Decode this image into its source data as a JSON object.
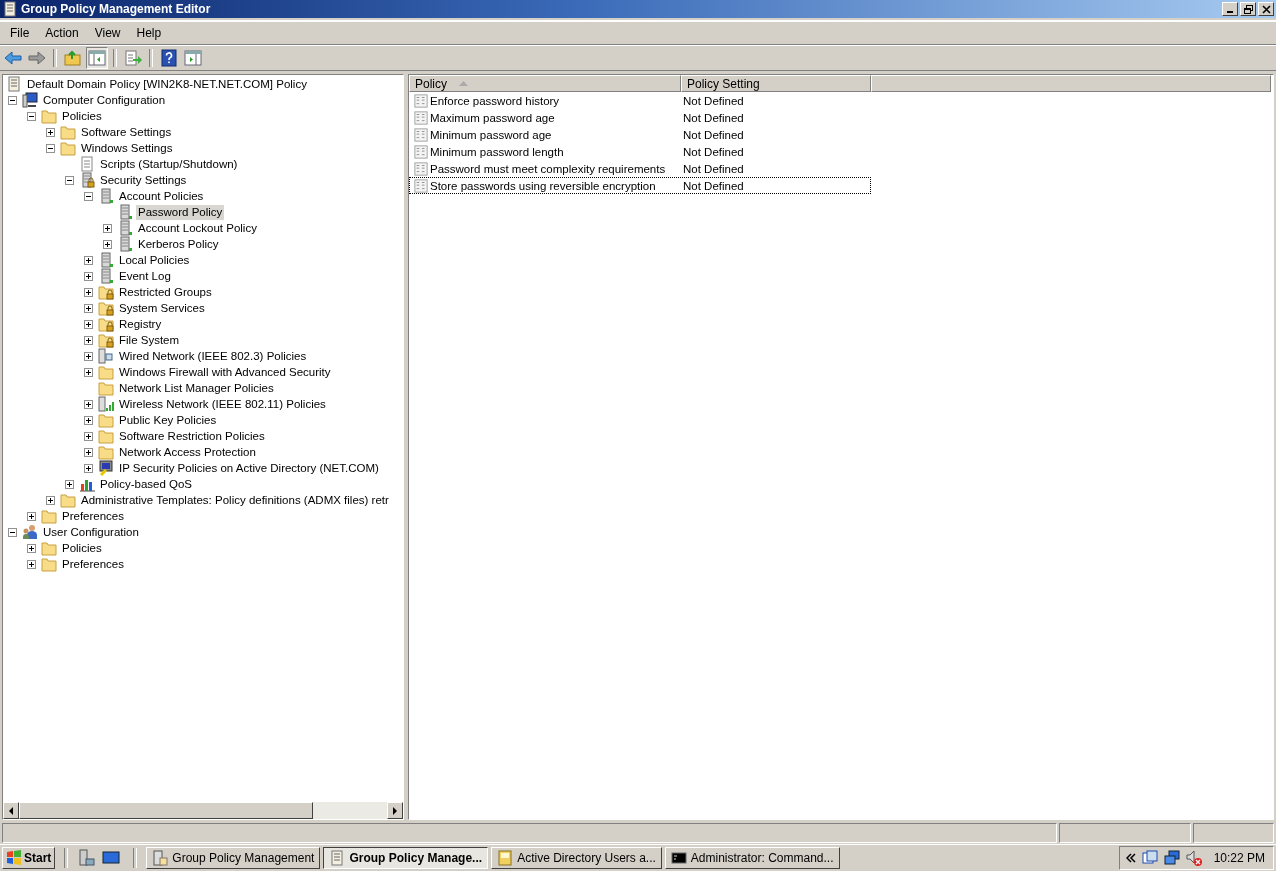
{
  "window": {
    "title": "Group Policy Management Editor"
  },
  "menu": [
    "File",
    "Action",
    "View",
    "Help"
  ],
  "toolbar": [
    {
      "kind": "back",
      "pressed": false
    },
    {
      "kind": "forward",
      "pressed": false
    },
    {
      "kind": "sep"
    },
    {
      "kind": "up",
      "pressed": false
    },
    {
      "kind": "tree",
      "pressed": true
    },
    {
      "kind": "sep"
    },
    {
      "kind": "export",
      "pressed": false
    },
    {
      "kind": "sep"
    },
    {
      "kind": "help",
      "pressed": false
    },
    {
      "kind": "actionpane",
      "pressed": false
    }
  ],
  "tree": {
    "label": "Default Domain Policy [WIN2K8-NET.NET.COM] Policy",
    "kind": "scroll",
    "selected": false,
    "children": [
      {
        "label": "Computer Configuration",
        "kind": "computer",
        "expanded": true,
        "selected": false,
        "children": [
          {
            "label": "Policies",
            "kind": "folder",
            "expanded": true,
            "selected": false,
            "children": [
              {
                "label": "Software Settings",
                "kind": "folder",
                "expanded": false,
                "selected": false
              },
              {
                "label": "Windows Settings",
                "kind": "folder",
                "expanded": true,
                "selected": false,
                "children": [
                  {
                    "label": "Scripts (Startup/Shutdown)",
                    "kind": "script",
                    "selected": false
                  },
                  {
                    "label": "Security Settings",
                    "kind": "security",
                    "expanded": true,
                    "selected": false,
                    "children": [
                      {
                        "label": "Account Policies",
                        "kind": "server",
                        "expanded": true,
                        "selected": false,
                        "children": [
                          {
                            "label": "Password Policy",
                            "kind": "server",
                            "selected": true
                          },
                          {
                            "label": "Account Lockout Policy",
                            "kind": "server",
                            "expanded": false,
                            "selected": false
                          },
                          {
                            "label": "Kerberos Policy",
                            "kind": "server",
                            "expanded": false,
                            "selected": false
                          }
                        ]
                      },
                      {
                        "label": "Local Policies",
                        "kind": "server",
                        "expanded": false,
                        "selected": false
                      },
                      {
                        "label": "Event Log",
                        "kind": "server",
                        "expanded": false,
                        "selected": false
                      },
                      {
                        "label": "Restricted Groups",
                        "kind": "lockfolder",
                        "expanded": false,
                        "selected": false
                      },
                      {
                        "label": "System Services",
                        "kind": "lockfolder",
                        "expanded": false,
                        "selected": false
                      },
                      {
                        "label": "Registry",
                        "kind": "lockfolder",
                        "expanded": false,
                        "selected": false
                      },
                      {
                        "label": "File System",
                        "kind": "lockfolder",
                        "expanded": false,
                        "selected": false
                      },
                      {
                        "label": "Wired Network (IEEE 802.3) Policies",
                        "kind": "wired",
                        "expanded": false,
                        "selected": false
                      },
                      {
                        "label": "Windows Firewall with Advanced Security",
                        "kind": "folder",
                        "expanded": false,
                        "selected": false
                      },
                      {
                        "label": "Network List Manager Policies",
                        "kind": "folder",
                        "selected": false
                      },
                      {
                        "label": "Wireless Network (IEEE 802.11) Policies",
                        "kind": "wireless",
                        "expanded": false,
                        "selected": false
                      },
                      {
                        "label": "Public Key Policies",
                        "kind": "folder",
                        "expanded": false,
                        "selected": false
                      },
                      {
                        "label": "Software Restriction Policies",
                        "kind": "folder",
                        "expanded": false,
                        "selected": false
                      },
                      {
                        "label": "Network Access Protection",
                        "kind": "folder",
                        "expanded": false,
                        "selected": false
                      },
                      {
                        "label": "IP Security Policies on Active Directory (NET.COM)",
                        "kind": "ipsec",
                        "expanded": false,
                        "selected": false
                      }
                    ]
                  },
                  {
                    "label": "Policy-based QoS",
                    "kind": "chart",
                    "expanded": false,
                    "selected": false
                  }
                ]
              },
              {
                "label": "Administrative Templates: Policy definitions (ADMX files) retr",
                "kind": "folder",
                "expanded": false,
                "selected": false
              }
            ]
          },
          {
            "label": "Preferences",
            "kind": "folder",
            "expanded": false,
            "selected": false
          }
        ]
      },
      {
        "label": "User Configuration",
        "kind": "user",
        "expanded": true,
        "selected": false,
        "children": [
          {
            "label": "Policies",
            "kind": "folder",
            "expanded": false,
            "selected": false
          },
          {
            "label": "Preferences",
            "kind": "folder",
            "expanded": false,
            "selected": false
          }
        ]
      }
    ]
  },
  "table": {
    "columns": [
      {
        "label": "Policy",
        "sorted": true
      },
      {
        "label": "Policy Setting",
        "sorted": false
      }
    ],
    "rows": [
      {
        "policy": "Enforce password history",
        "setting": "Not Defined",
        "focused": false
      },
      {
        "policy": "Maximum password age",
        "setting": "Not Defined",
        "focused": false
      },
      {
        "policy": "Minimum password age",
        "setting": "Not Defined",
        "focused": false
      },
      {
        "policy": "Minimum password length",
        "setting": "Not Defined",
        "focused": false
      },
      {
        "policy": "Password must meet complexity requirements",
        "setting": "Not Defined",
        "focused": false
      },
      {
        "policy": "Store passwords using reversible encryption",
        "setting": "Not Defined",
        "focused": true
      }
    ]
  },
  "taskbar": {
    "start": "Start",
    "tasks": [
      {
        "label": "Group Policy Management",
        "kind": "gpm",
        "selected": false
      },
      {
        "label": "Group Policy Manage...",
        "kind": "scroll",
        "selected": true
      },
      {
        "label": "Active Directory Users a...",
        "kind": "book",
        "selected": false
      },
      {
        "label": "Administrator: Command...",
        "kind": "cmd",
        "selected": false
      }
    ],
    "clock": "10:22 PM"
  }
}
